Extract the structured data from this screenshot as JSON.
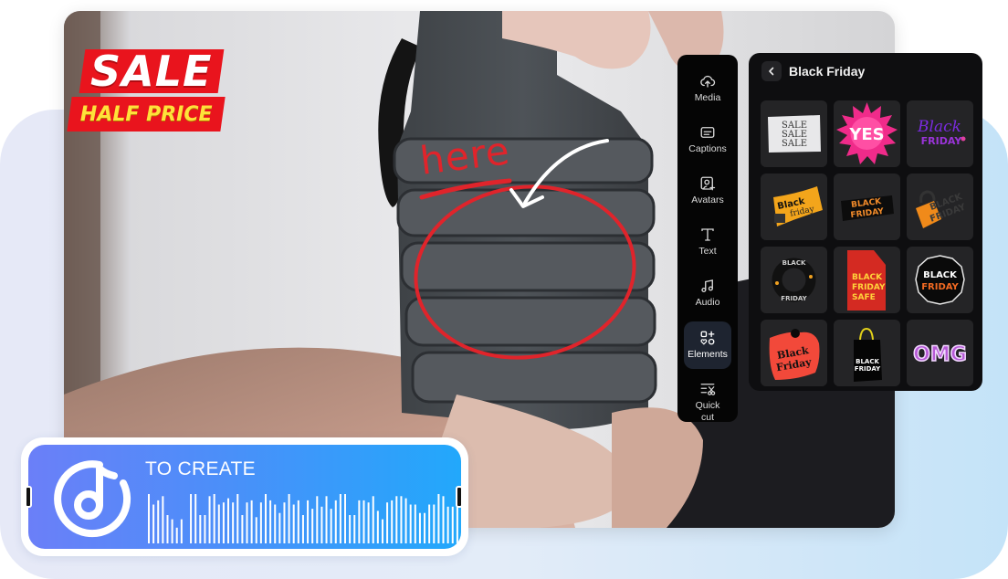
{
  "photo": {
    "description": "Hand holding a collapsible grey water bottle",
    "annotation_text": "here",
    "annotation_color": "#e0242b"
  },
  "sale_sticker": {
    "line1": "SALE",
    "line2": "HALF PRICE",
    "bg_color": "#e9141d",
    "line2_color": "#ffe23a"
  },
  "toolbar": {
    "items": [
      {
        "label": "Media",
        "icon": "cloud-upload-icon",
        "active": false
      },
      {
        "label": "Captions",
        "icon": "captions-icon",
        "active": false
      },
      {
        "label": "Avatars",
        "icon": "avatar-add-icon",
        "active": false
      },
      {
        "label": "Text",
        "icon": "text-icon",
        "active": false
      },
      {
        "label": "Audio",
        "icon": "music-note-icon",
        "active": false
      },
      {
        "label": "Elements",
        "icon": "elements-icon",
        "active": true
      },
      {
        "label": "Quick cut",
        "label_line1": "Quick",
        "label_line2": "cut",
        "icon": "quick-cut-icon",
        "active": false
      }
    ]
  },
  "panel": {
    "back_icon": "chevron-left-icon",
    "title": "Black Friday",
    "stickers": [
      {
        "name": "sale-sale-sale",
        "text": [
          "SALE",
          "SALE",
          "SALE"
        ]
      },
      {
        "name": "yes-burst",
        "text": [
          "YES"
        ]
      },
      {
        "name": "black-friday-script",
        "text": [
          "Black",
          "FRIDAY"
        ]
      },
      {
        "name": "black-friday-flag",
        "text": [
          "Black",
          "friday"
        ]
      },
      {
        "name": "black-friday-brush",
        "text": [
          "BLACK",
          "FRIDAY"
        ]
      },
      {
        "name": "black-friday-lock",
        "text": [
          "BLACK",
          "FRIDAY"
        ]
      },
      {
        "name": "black-friday-ring",
        "text": [
          "BLACK",
          "FRIDAY"
        ]
      },
      {
        "name": "black-friday-safe-tag",
        "text": [
          "BLACK",
          "FRIDAY",
          "SAFE"
        ]
      },
      {
        "name": "black-friday-badge",
        "text": [
          "BLACK",
          "FRIDAY"
        ]
      },
      {
        "name": "black-friday-price-tag",
        "text": [
          "Black",
          "Friday"
        ]
      },
      {
        "name": "black-friday-bag",
        "text": [
          "BLACK",
          "FRIDAY"
        ]
      },
      {
        "name": "omg-balloon",
        "text": [
          "OMG"
        ]
      }
    ]
  },
  "audio_card": {
    "title": "TO CREATE",
    "icon": "music-disc-icon",
    "waveform_levels": [
      1.0,
      0.75,
      0.85,
      0.95,
      0.5,
      0.4,
      0.2,
      0.4,
      0,
      1.0,
      1.0,
      0.5,
      0.5,
      0.95,
      1.0,
      0.75,
      0.8,
      0.9,
      0.8,
      1.0,
      0.5,
      0.8,
      0.85,
      0.45,
      0.8,
      1.0,
      0.85,
      0.75,
      0.55,
      0.8,
      1.0,
      0.75,
      0.85,
      0.5,
      0.85,
      0.65,
      0.95,
      0.7,
      0.95,
      0.65,
      0.85,
      1.0,
      1.0,
      0.5,
      0.5,
      0.85,
      0.85,
      0.8,
      0.95,
      0.6,
      0.4,
      0.8,
      0.85,
      0.95,
      0.95,
      0.9,
      0.75,
      0.75,
      0.55,
      0.55,
      0.75,
      0.75,
      1.0,
      0.95,
      0.7,
      0.7,
      0.8
    ]
  }
}
